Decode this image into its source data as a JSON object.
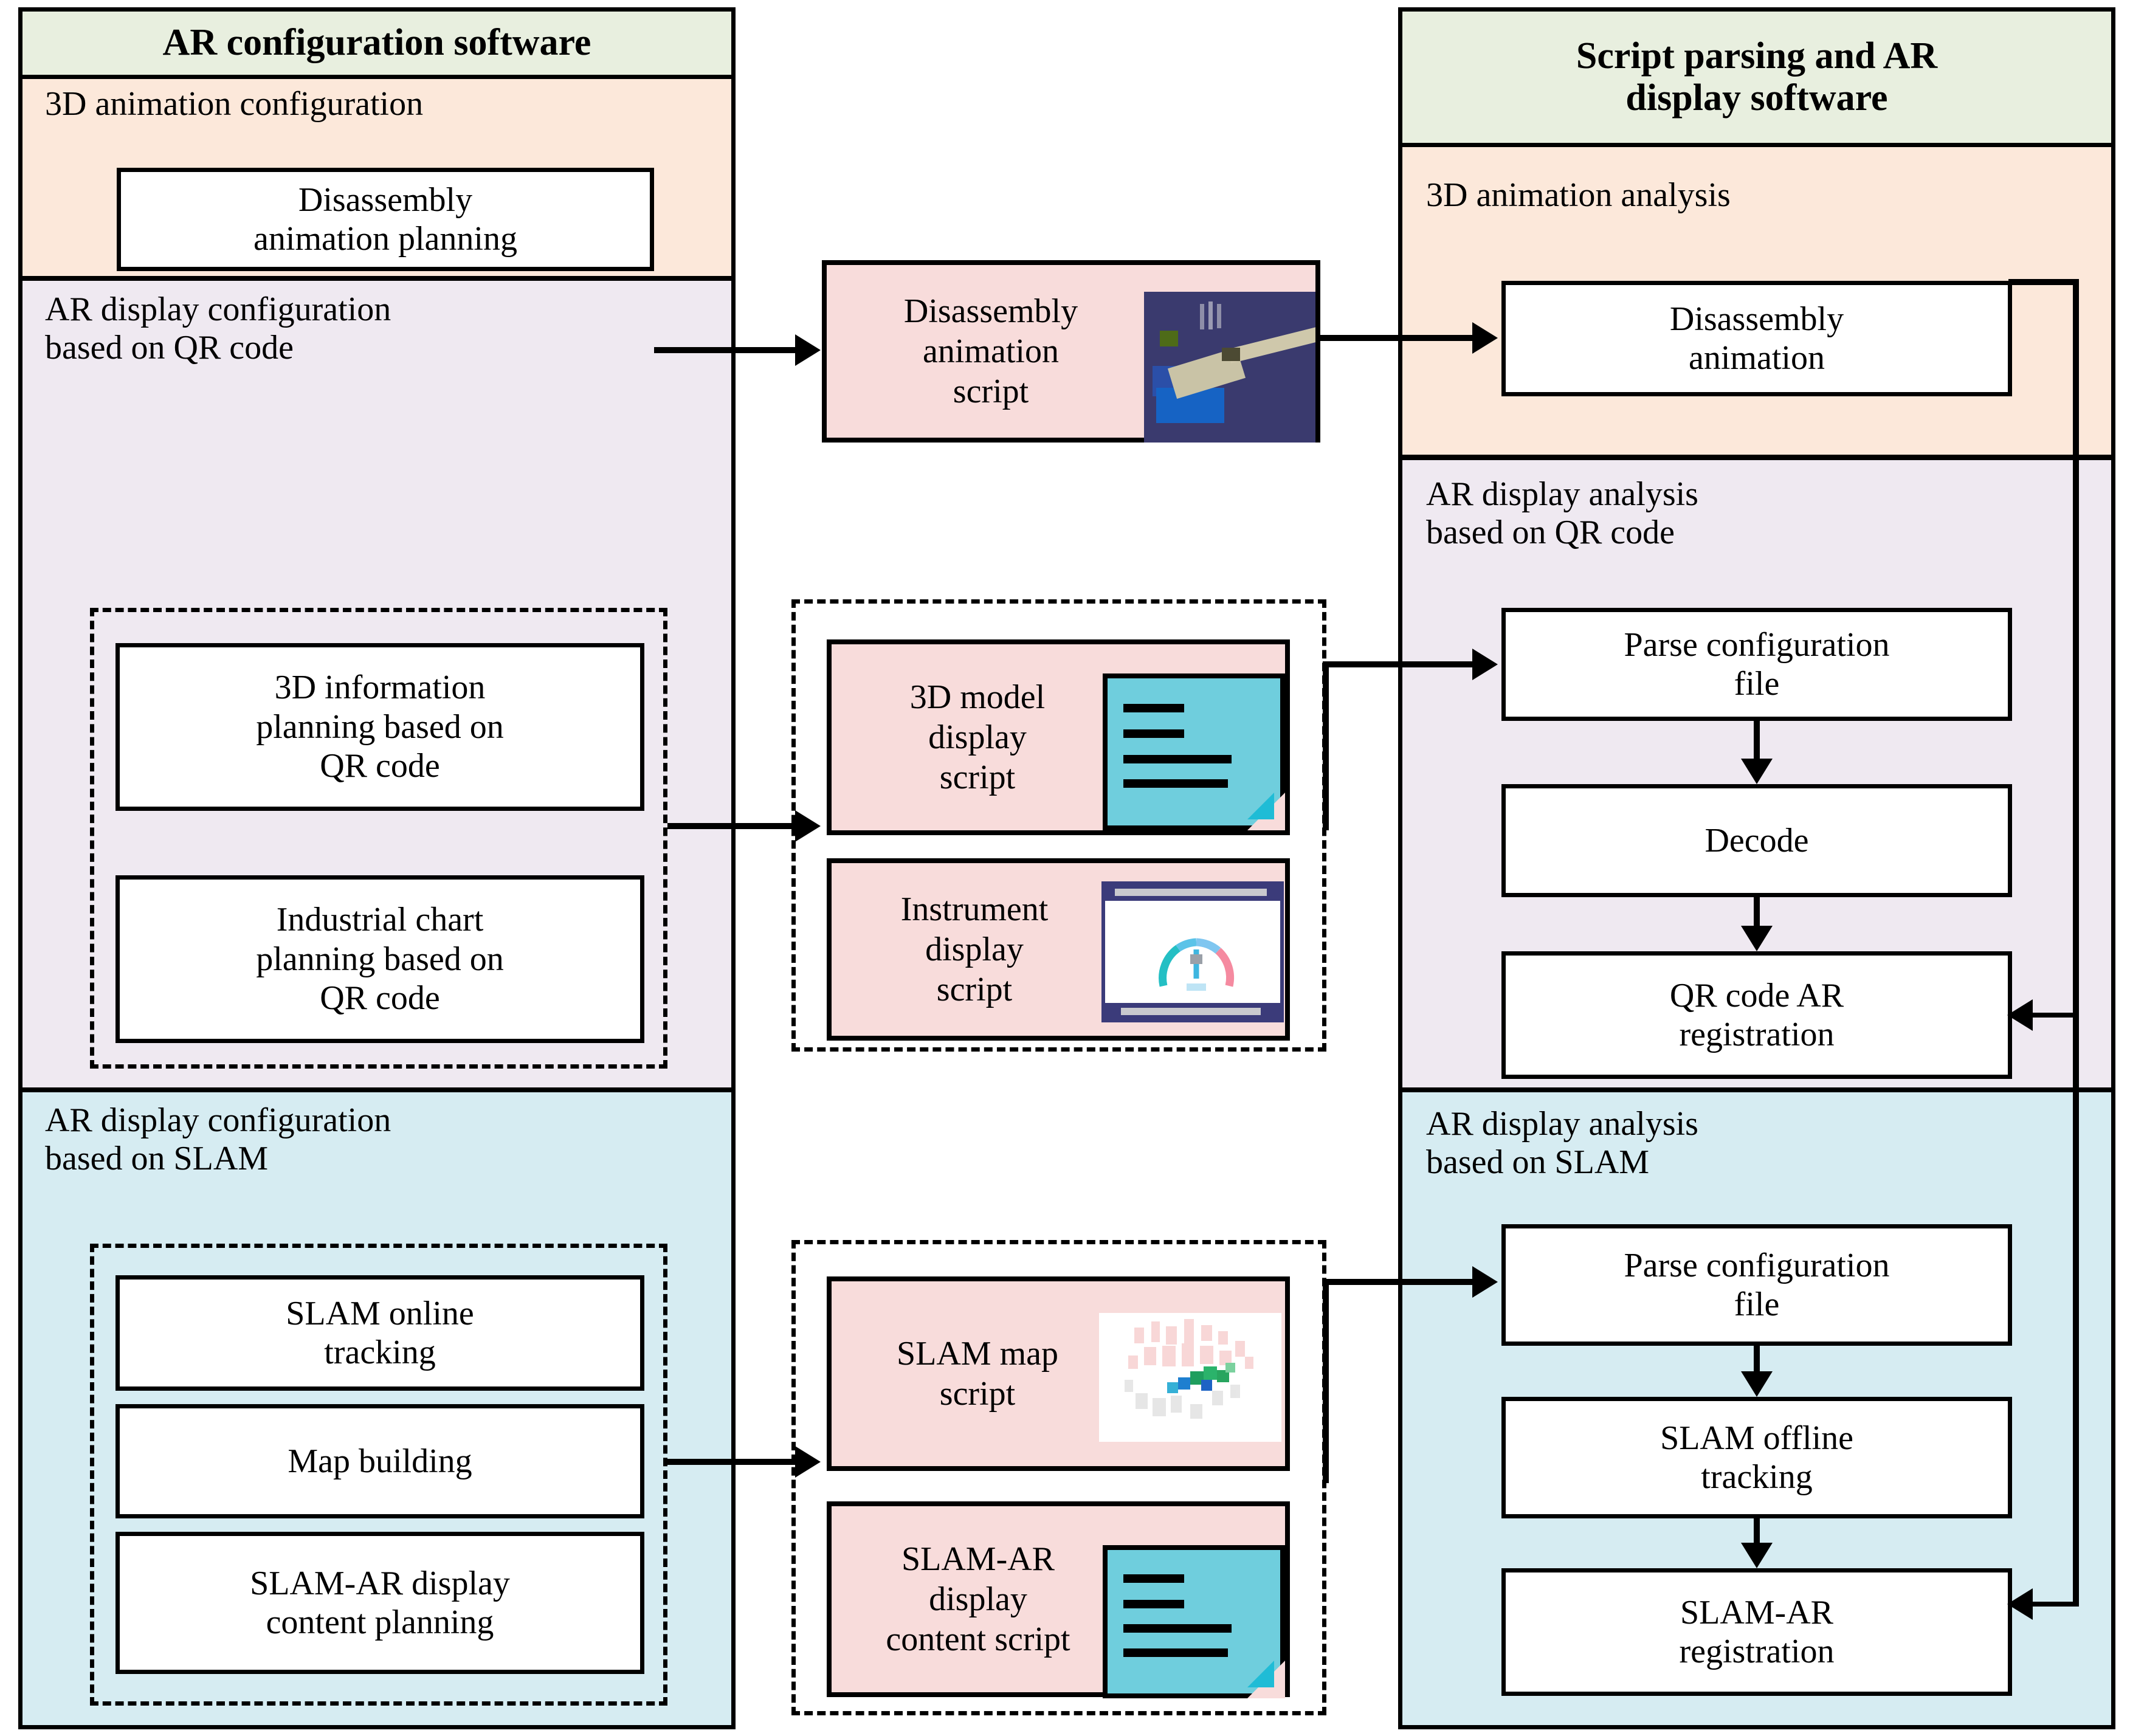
{
  "left_column": {
    "header": "AR configuration software",
    "sections": [
      {
        "title": "3D animation configuration",
        "nodes": [
          "Disassembly\nanimation planning"
        ]
      },
      {
        "title": "AR display configuration\nbased on QR code",
        "nodes": [
          "3D information\nplanning based on\nQR code",
          "Industrial chart\nplanning based on\nQR code"
        ]
      },
      {
        "title": "AR display configuration\nbased on SLAM",
        "nodes": [
          "SLAM online\ntracking",
          "Map building",
          "SLAM-AR display\ncontent planning"
        ]
      }
    ]
  },
  "middle_column": {
    "scripts": [
      {
        "label": "Disassembly\nanimation\nscript",
        "thumb": "disassembly-animation-thumbnail"
      },
      {
        "label": "3D model\ndisplay\nscript",
        "thumb": "document-page-icon"
      },
      {
        "label": "Instrument\ndisplay\nscript",
        "thumb": "instrument-gauge-thumbnail"
      },
      {
        "label": "SLAM map\nscript",
        "thumb": "slam-point-cloud-map-thumbnail"
      },
      {
        "label": "SLAM-AR\ndisplay\ncontent script",
        "thumb": "document-page-icon"
      }
    ]
  },
  "right_column": {
    "header": "Script parsing and AR\ndisplay software",
    "sections": [
      {
        "title": "3D animation analysis",
        "nodes": [
          "Disassembly\nanimation"
        ]
      },
      {
        "title": "AR display analysis\nbased on QR code",
        "nodes": [
          "Parse configuration\nfile",
          "Decode",
          "QR code AR\nregistration"
        ]
      },
      {
        "title": "AR display analysis\nbased on SLAM",
        "nodes": [
          "Parse configuration\nfile",
          "SLAM offline\ntracking",
          "SLAM-AR\nregistration"
        ]
      }
    ]
  },
  "colors": {
    "header_green": "#E8EFDF",
    "animation_orange": "#FCE8DA",
    "qr_purple": "#EFE9F1",
    "slam_blue": "#D6ECF2",
    "script_pink": "#F8DCDB",
    "doc_icon_blue": "#6FCEDD",
    "outline_black": "#000000"
  }
}
